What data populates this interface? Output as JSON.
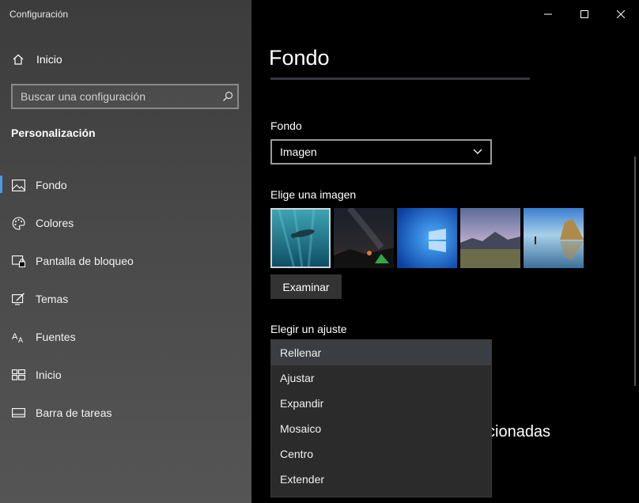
{
  "window": {
    "title": "Configuración"
  },
  "sidebar": {
    "home_label": "Inicio",
    "search_placeholder": "Buscar una configuración",
    "section_heading": "Personalización",
    "items": [
      {
        "label": "Fondo",
        "icon": "image-icon",
        "active": true
      },
      {
        "label": "Colores",
        "icon": "palette-icon",
        "active": false
      },
      {
        "label": "Pantalla de bloqueo",
        "icon": "lock-screen-icon",
        "active": false
      },
      {
        "label": "Temas",
        "icon": "themes-icon",
        "active": false
      },
      {
        "label": "Fuentes",
        "icon": "fonts-icon",
        "active": false
      },
      {
        "label": "Inicio",
        "icon": "start-icon",
        "active": false
      },
      {
        "label": "Barra de tareas",
        "icon": "taskbar-icon",
        "active": false
      }
    ]
  },
  "main": {
    "page_title": "Fondo",
    "background_label": "Fondo",
    "background_value": "Imagen",
    "choose_image_label": "Elige una imagen",
    "thumbnails": [
      "underwater-swimmer",
      "night-sky-tent",
      "windows-default",
      "mountain-landscape",
      "beach-rocks-reflection"
    ],
    "browse_label": "Examinar",
    "fit_label": "Elegir un ajuste",
    "fit_options": [
      "Rellenar",
      "Ajustar",
      "Expandir",
      "Mosaico",
      "Centro",
      "Extender"
    ],
    "fit_selected": "Rellenar",
    "obscured_text": "cionadas"
  },
  "colors": {
    "accent": "#4c9be8",
    "sidebar": "#4a4a4a",
    "main_bg": "#000000",
    "dropdown_bg": "#2b2b2b"
  }
}
